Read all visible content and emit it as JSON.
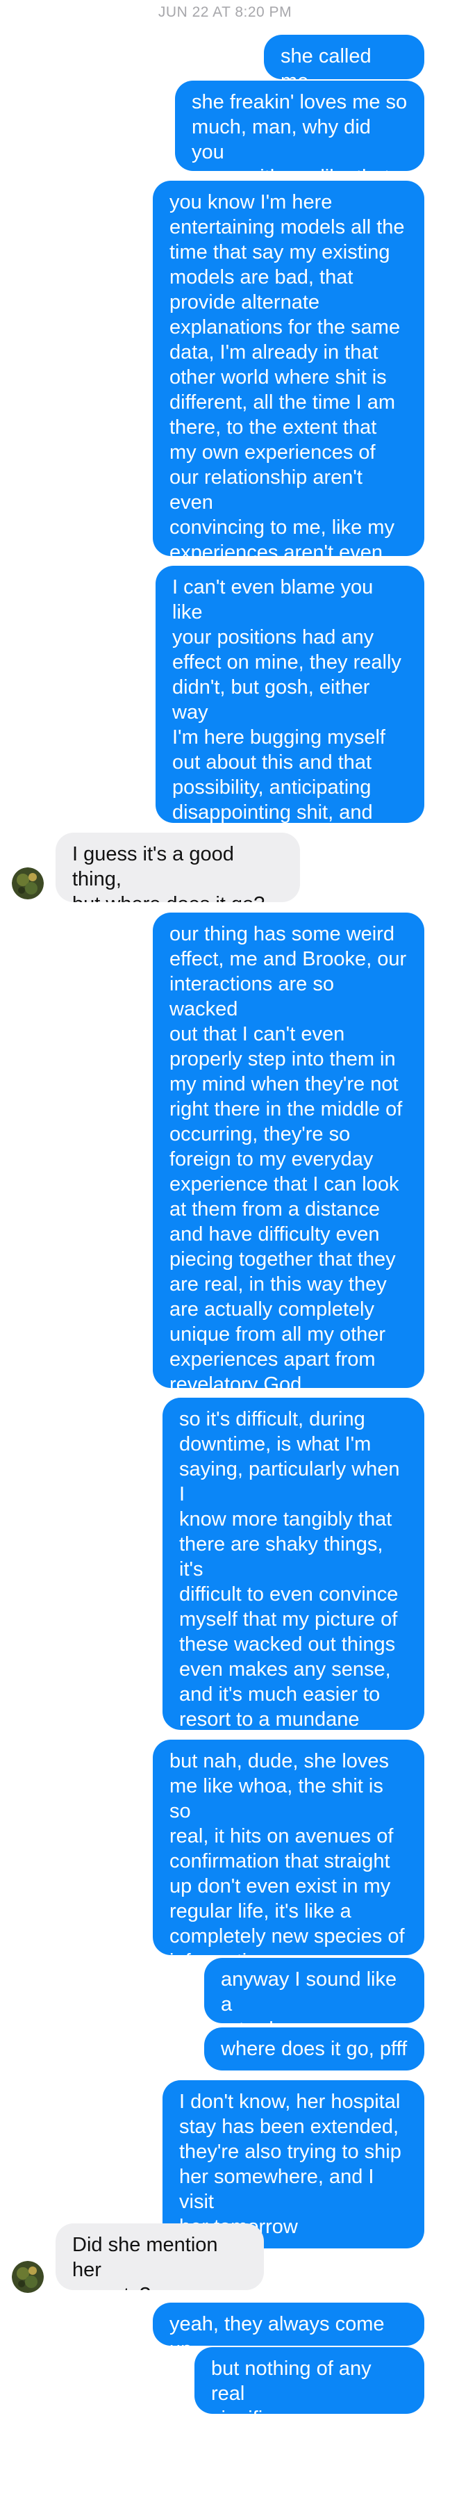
{
  "header": {
    "timestamp": "JUN 22 AT 8:20 PM"
  },
  "messages": [
    {
      "text": "she called me,"
    },
    {
      "text": "she freakin' loves me so\nmuch, man, why did you\nmess with me like that"
    },
    {
      "text": "you know I'm here\nentertaining models all the\ntime that say my existing\nmodels are bad, that\nprovide alternate\nexplanations for the same\ndata, I'm already in that\nother world where shit is\ndifferent, all the time I am\nthere, to the extent that\nmy own experiences of\nour relationship aren't even\nconvincing to me, like my\nexperiences aren't even as\nreal as the models"
    },
    {
      "text": "I can't even blame you like\nyour positions had any\neffect on mine, they really\ndidn't, but gosh, either way\nI'm here bugging myself\nout about this and that\npossibility, anticipating\ndisappointing shit, and\nmeanwhile you're just\nhitting me"
    },
    {
      "text": "I guess it's a good thing,\nbut where does it go?"
    },
    {
      "text": "our thing has some weird\neffect, me and Brooke, our\ninteractions are so wacked\nout that I can't even\nproperly step into them in\nmy mind when they're not\nright there in the middle of\noccurring, they're so\nforeign to my everyday\nexperience that I can look\nat them from a distance\nand have difficulty even\npiecing together that they\nare real, in this way they\nare actually completely\nunique from all my other\nexperiences apart from\nrevelatory God\nexperiences"
    },
    {
      "text": "so it's difficult, during\ndowntime, is what I'm\nsaying, particularly when I\nknow more tangibly that\nthere are shaky things, it's\ndifficult to even convince\nmyself that my picture of\nthese wacked out things\neven makes any sense,\nand it's much easier to\nresort to a mundane\nexplanation, which is\nprobably a shitty one"
    },
    {
      "text": "but nah, dude, she loves\nme like whoa, the shit is so\nreal, it hits on avenues of\nconfirmation that straight\nup don't even exist in my\nregular life, it's like a\ncompletely new species of\ninformation"
    },
    {
      "text": "anyway I sound like a\nretard"
    },
    {
      "text": "where does it go, pfff"
    },
    {
      "text": "I don't know, her hospital\nstay has been extended,\nthey're also trying to ship\nher somewhere, and I visit\nher tomorrow"
    },
    {
      "text": "Did she mention her\nparents?"
    },
    {
      "text": "yeah, they always come up"
    },
    {
      "text": "but nothing of any real\nsignificance"
    }
  ],
  "colors": {
    "outgoing": "#0b86f7",
    "incoming": "#eeeef0",
    "timestamp": "#a7a7ab"
  }
}
